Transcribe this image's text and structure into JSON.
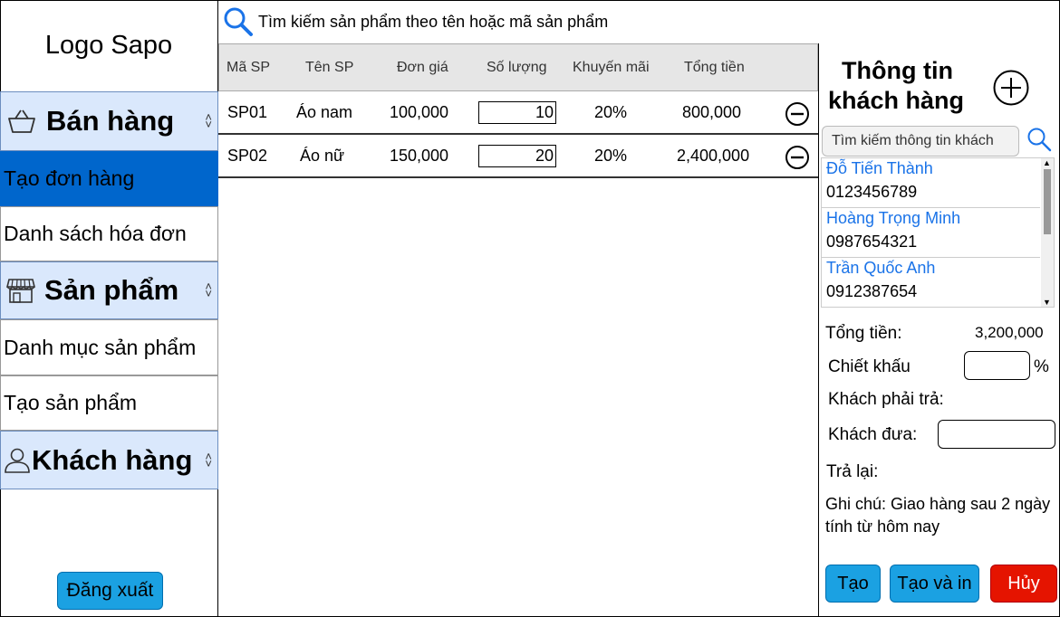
{
  "sidebar": {
    "logo": "Logo Sapo",
    "sections": [
      {
        "label": "Bán hàng",
        "icon": "basket-icon"
      },
      {
        "label": "Sản phẩm",
        "icon": "store-icon"
      },
      {
        "label": "Khách hàng",
        "icon": "user-icon"
      }
    ],
    "items": {
      "create_order": "Tạo đơn hàng",
      "invoice_list": "Danh sách hóa đơn",
      "product_catalog": "Danh mục sản phẩm",
      "create_product": "Tạo sản phẩm"
    },
    "logout": "Đăng xuất"
  },
  "search": {
    "placeholder": "Tìm kiếm sản phẩm theo tên hoặc mã sản phẩm"
  },
  "table": {
    "headers": [
      "Mã SP",
      "Tên SP",
      "Đơn giá",
      "Số lượng",
      "Khuyến mãi",
      "Tổng tiền"
    ],
    "rows": [
      {
        "code": "SP01",
        "name": "Áo nam",
        "price": "100,000",
        "qty": "10",
        "promo": "20%",
        "total": "800,000"
      },
      {
        "code": "SP02",
        "name": "Áo nữ",
        "price": "150,000",
        "qty": "20",
        "promo": "20%",
        "total": "2,400,000"
      }
    ]
  },
  "customer": {
    "title_line1": "Thông tin",
    "title_line2": "khách hàng",
    "search_placeholder": "Tìm kiếm thông tin khách",
    "list": [
      {
        "name": "Đỗ Tiến Thành",
        "phone": "0123456789"
      },
      {
        "name": "Hoàng Trọng Minh",
        "phone": "0987654321"
      },
      {
        "name": "Trần Quốc Anh",
        "phone": "0912387654"
      }
    ],
    "total_label": "Tổng tiền:",
    "total_value": "3,200,000",
    "discount_label": "Chiết khấu",
    "percent_sign": "%",
    "must_pay_label": "Khách phải trả:",
    "given_label": "Khách đưa:",
    "change_label": "Trả lại:",
    "note": "Ghi chú: Giao hàng sau 2 ngày tính từ hôm nay",
    "buttons": {
      "create": "Tạo",
      "create_print": "Tạo và in",
      "cancel": "Hủy"
    }
  },
  "colors": {
    "accent": "#1ba1e2",
    "active_item": "#0066cc",
    "section_bg": "#dae8fc",
    "link": "#1a73e8",
    "danger": "#e51400"
  }
}
